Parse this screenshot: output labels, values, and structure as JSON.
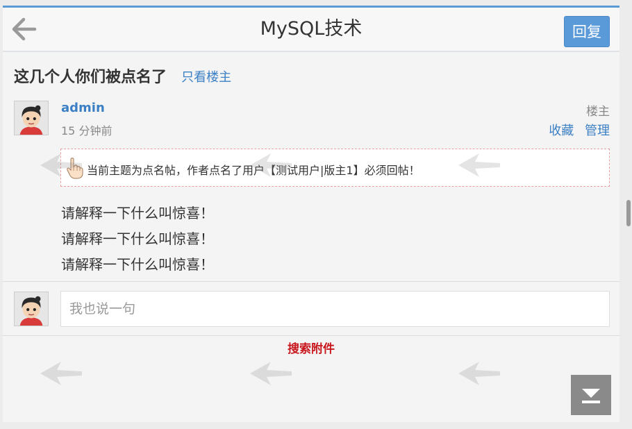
{
  "header": {
    "title": "MySQL技术",
    "reply_label": "回复"
  },
  "thread": {
    "title": "这几个人你们被点名了",
    "only_op_label": "只看楼主"
  },
  "post": {
    "author": "admin",
    "time": "15 分钟前",
    "op_badge": "楼主",
    "actions": [
      "收藏",
      "管理"
    ],
    "notice": "当前主题为点名帖，作者点名了用户【测试用户|版主1】必须回帖！",
    "body_lines": [
      "请解释一下什么叫惊喜！",
      "请解释一下什么叫惊喜！",
      "请解释一下什么叫惊喜！"
    ]
  },
  "comment": {
    "placeholder": "我也说一句"
  },
  "search_attach_label": "搜索附件",
  "colors": {
    "accent": "#5b9ad8",
    "link": "#3b7fc4",
    "alert": "#c8161d"
  },
  "icons": [
    "back-arrow-icon",
    "pointing-hand-icon",
    "scroll-down-icon",
    "user-avatar"
  ]
}
